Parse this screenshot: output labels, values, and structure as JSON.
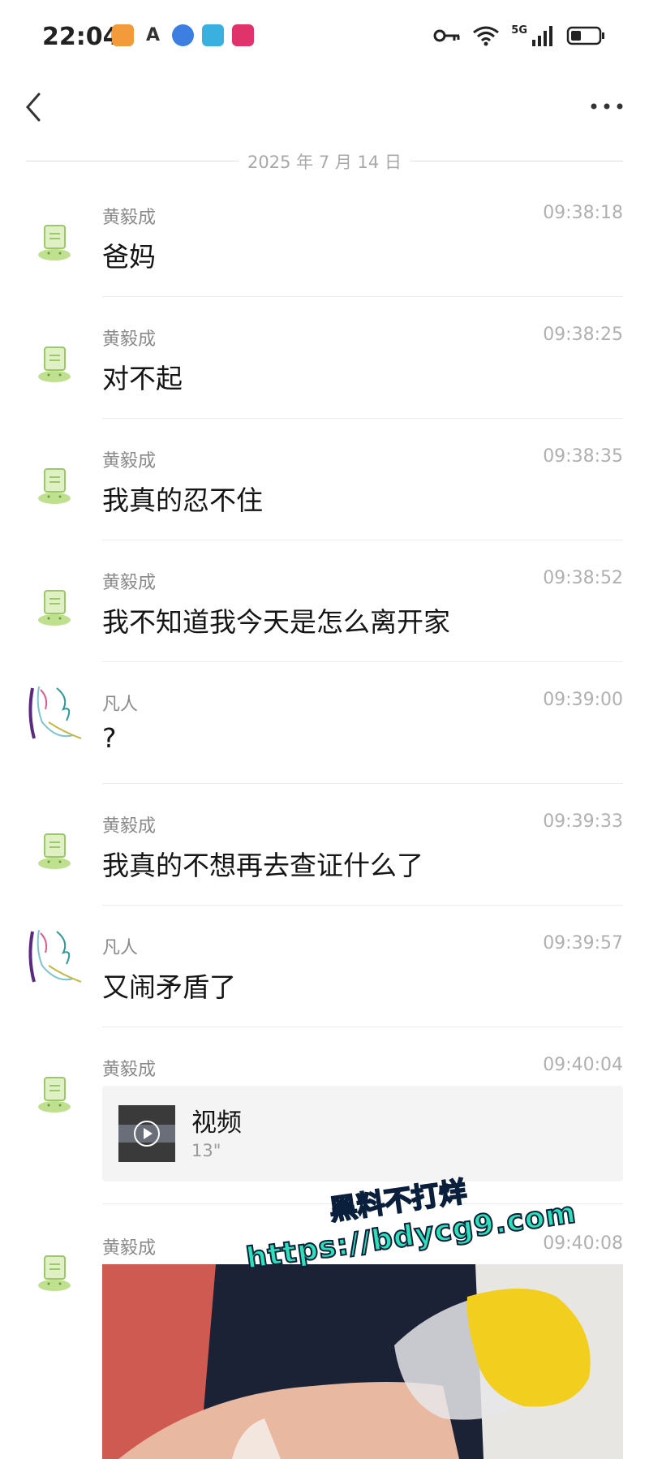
{
  "status_bar": {
    "time": "22:04",
    "network": "5G"
  },
  "nav": {
    "back_icon": "chevron-left-icon",
    "more_icon": "more-horizontal-icon"
  },
  "date_separator": "2025 年 7 月 14 日",
  "messages": [
    {
      "sender": "黄毅成",
      "time": "09:38:18",
      "text": "爸妈"
    },
    {
      "sender": "黄毅成",
      "time": "09:38:25",
      "text": "对不起"
    },
    {
      "sender": "黄毅成",
      "time": "09:38:35",
      "text": "我真的忍不住"
    },
    {
      "sender": "黄毅成",
      "time": "09:38:52",
      "text": "我不知道我今天是怎么离开家"
    },
    {
      "sender": "凡人",
      "time": "09:39:00",
      "text": "?"
    },
    {
      "sender": "黄毅成",
      "time": "09:39:33",
      "text": "我真的不想再去查证什么了"
    },
    {
      "sender": "凡人",
      "time": "09:39:57",
      "text": "又闹矛盾了"
    },
    {
      "sender": "黄毅成",
      "time": "09:40:04",
      "video_title": "视频",
      "video_duration": "13\""
    },
    {
      "sender": "黄毅成",
      "time": "09:40:08"
    }
  ],
  "watermark": {
    "line1": "黑料不打烊",
    "line2": "https://bdycg9.com"
  },
  "colors": {
    "accent_watermark": "#2de0b7",
    "avatar_green": "#b8d98a",
    "timestamp_gray": "#b0b0b0"
  }
}
